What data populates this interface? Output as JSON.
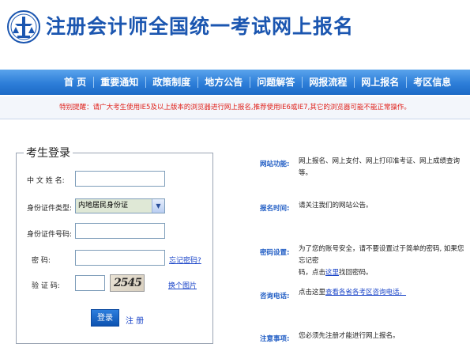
{
  "header": {
    "title": "注册会计师全国统一考试网上报名"
  },
  "nav": {
    "items": [
      "首  页",
      "重要通知",
      "政策制度",
      "地方公告",
      "问题解答",
      "网报流程",
      "网上报名",
      "考区信息"
    ]
  },
  "notice": "特别提醒：请广大考生使用IE5及以上版本的浏览器进行网上报名,推荐使用IE6或IE7,其它的浏览器可能不能正常操作。",
  "login": {
    "legend": "考生登录",
    "name_label": "中 文 姓 名:",
    "name_value": "",
    "id_type_label": "身份证件类型:",
    "id_type_value": "内地居民身份证",
    "id_no_label": "身份证件号码:",
    "id_no_value": "",
    "password_label": "密        码:",
    "password_value": "",
    "forgot_password": "忘记密码?",
    "captcha_label": "验  证  码:",
    "captcha_value": "",
    "captcha_image_text": "2545",
    "change_image": "换个图片",
    "login_button": "登录",
    "register_link": "注 册"
  },
  "info": {
    "features_label": "网站功能:",
    "features_text": "网上报名、网上支付、网上打印准考证、网上成绩查询等。",
    "exam_time_label": "报名时间:",
    "exam_time_text": "请关注我们的网站公告。",
    "password_set_label": "密码设置:",
    "password_set_text_a": "为了您的账号安全，请不要设置过于简单的密码, 如果您忘记密",
    "password_set_text_b": "码，点击",
    "password_set_link": "这里",
    "password_set_text_c": "找回密码。",
    "hotline_label": "咨询电话:",
    "hotline_text": "点击这里",
    "hotline_link": "查看各省各考区咨询电话。",
    "notes_label": "注意事项:",
    "notes_text": "您必须先注册才能进行网上报名。"
  }
}
